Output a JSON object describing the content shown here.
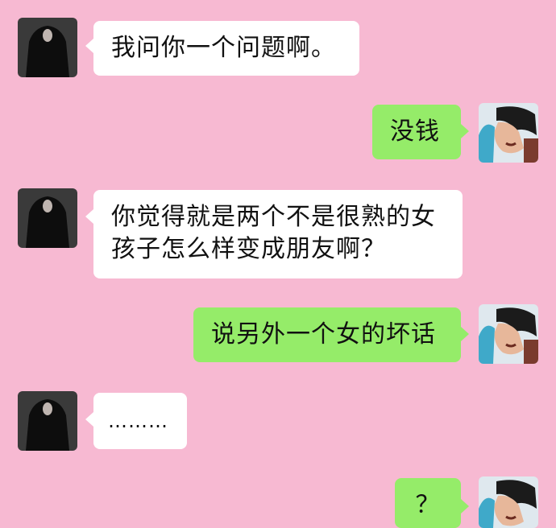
{
  "chat": {
    "messages": [
      {
        "sender": "other",
        "text": "我问你一个问题啊。"
      },
      {
        "sender": "me",
        "text": "没钱"
      },
      {
        "sender": "other",
        "lines": [
          "你觉得就是两个不是很熟的女",
          "孩子怎么样变成朋友啊？"
        ]
      },
      {
        "sender": "me",
        "text": "说另外一个女的坏话"
      },
      {
        "sender": "other",
        "text": "………"
      },
      {
        "sender": "me",
        "text": "？"
      }
    ]
  },
  "colors": {
    "background": "#f7b9d2",
    "incoming_bubble": "#ffffff",
    "outgoing_bubble": "#95ec69"
  }
}
